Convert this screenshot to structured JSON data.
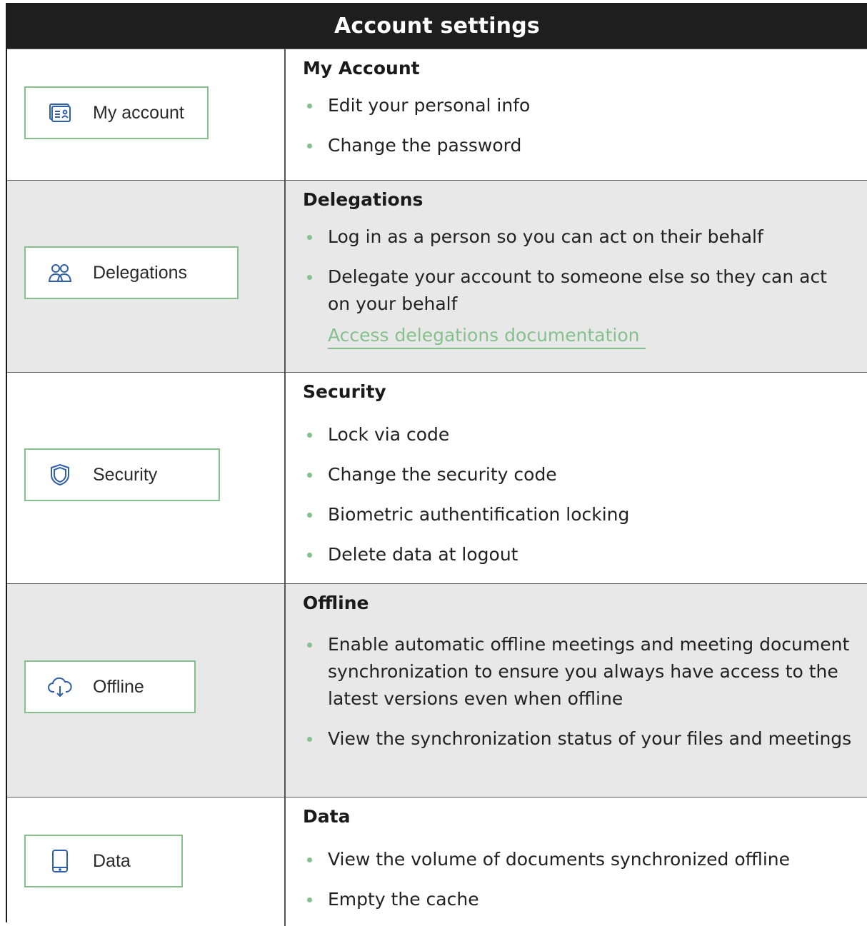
{
  "title": "Account settings",
  "colors": {
    "accent": "#86c08d",
    "header_bg": "#1e1e1e",
    "shade": "#e8e8e8"
  },
  "rows": [
    {
      "button": {
        "label": "My account",
        "icon": "id-card-icon"
      },
      "heading": "My Account",
      "items": [
        "Edit your personal info",
        "Change the password"
      ]
    },
    {
      "button": {
        "label": "Delegations",
        "icon": "users-icon"
      },
      "heading": "Delegations",
      "items": [
        "Log in as a person so you can act on their behalf",
        "Delegate your account to someone else so they can act on your behalf"
      ],
      "link": "Access delegations documentation"
    },
    {
      "button": {
        "label": "Security",
        "icon": "shield-icon"
      },
      "heading": "Security",
      "items": [
        "Lock via code",
        "Change the security code",
        "Biometric authentification locking",
        "Delete data at logout"
      ]
    },
    {
      "button": {
        "label": "Offline",
        "icon": "cloud-download-icon"
      },
      "heading": "Offline",
      "items": [
        "Enable automatic offline meetings and meeting document synchronization to ensure you always have access to the latest versions even when offline",
        "View the synchronization status of your files and meetings"
      ]
    },
    {
      "button": {
        "label": "Data",
        "icon": "phone-icon"
      },
      "heading": "Data",
      "items": [
        "View the volume of documents synchronized offline",
        "Empty the cache"
      ]
    }
  ]
}
